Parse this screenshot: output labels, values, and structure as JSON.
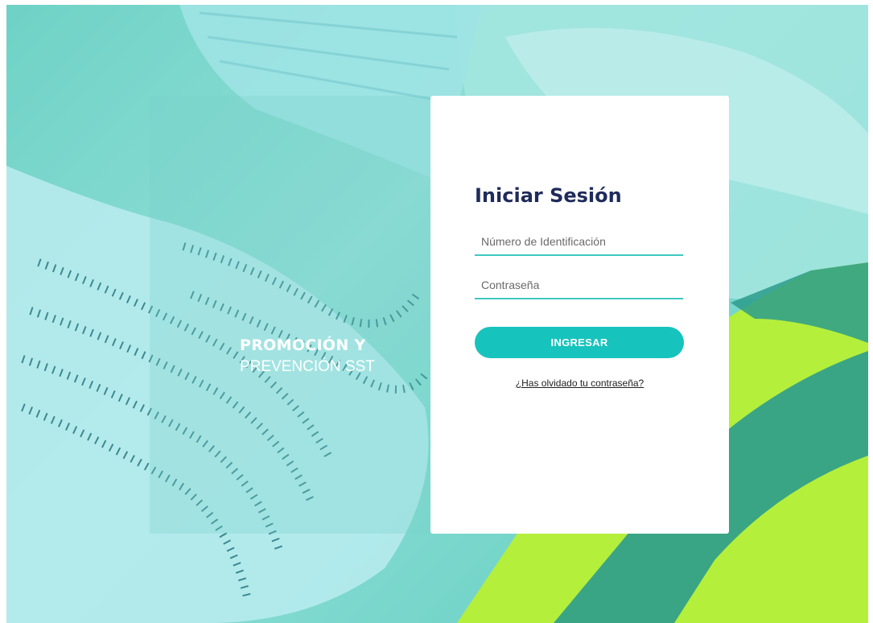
{
  "brand": {
    "line1": "PROMOCIÓN Y",
    "line2": "PREVENCIÓN SST"
  },
  "login": {
    "title": "Iniciar Sesión",
    "id_field": {
      "placeholder": "Número de Identificación",
      "value": ""
    },
    "password_field": {
      "placeholder": "Contraseña",
      "value": ""
    },
    "submit_label": "INGRESAR",
    "forgot_label": "¿Has olvidado tu contraseña?"
  },
  "colors": {
    "accent": "#17c3bd",
    "underline": "#3ec9c0",
    "title": "#1f2b5b",
    "background_teal": "#6fd2c6",
    "vest_green": "#b4ef3c"
  },
  "background": {
    "image_subject": "safety-equipment-photo"
  }
}
